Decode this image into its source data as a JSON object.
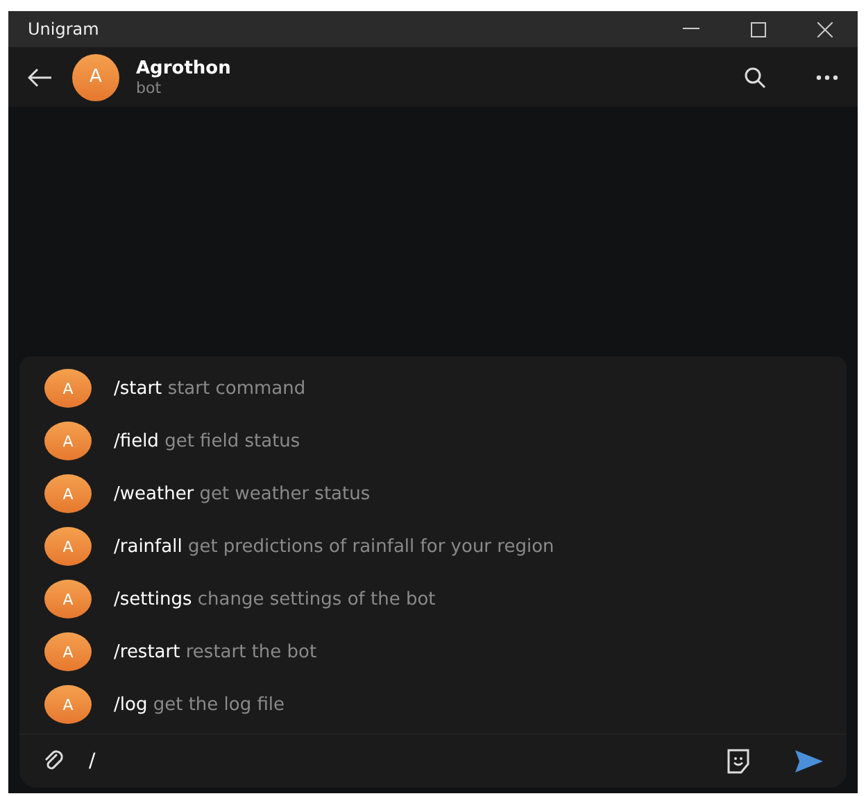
{
  "window": {
    "title": "Unigram"
  },
  "chat": {
    "avatar_letter": "A",
    "name": "Agrothon",
    "status": "bot"
  },
  "commands": [
    {
      "avatar_letter": "A",
      "command": "/start",
      "description": "start command"
    },
    {
      "avatar_letter": "A",
      "command": "/field",
      "description": "get field status"
    },
    {
      "avatar_letter": "A",
      "command": "/weather",
      "description": "get weather status"
    },
    {
      "avatar_letter": "A",
      "command": "/rainfall",
      "description": "get predictions of rainfall for your region"
    },
    {
      "avatar_letter": "A",
      "command": "/settings",
      "description": "change settings of the bot"
    },
    {
      "avatar_letter": "A",
      "command": "/restart",
      "description": "restart the bot"
    },
    {
      "avatar_letter": "A",
      "command": "/log",
      "description": "get the log file"
    }
  ],
  "composer": {
    "value": "/"
  }
}
